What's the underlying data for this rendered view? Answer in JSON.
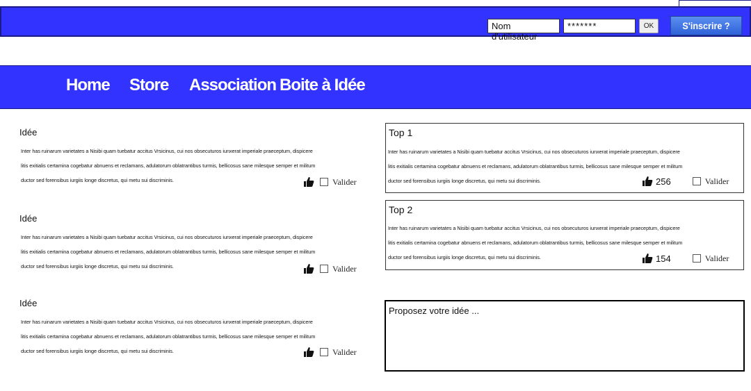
{
  "header": {
    "username_label": "Nom d'utilisateur",
    "password_mask": "*******",
    "ok_label": "OK",
    "signup_label": "S'inscrire ?"
  },
  "nav": {
    "items": [
      {
        "label": "Home"
      },
      {
        "label": "Store"
      },
      {
        "label": "Association"
      },
      {
        "label": "Boite à Idée"
      }
    ]
  },
  "lorem": {
    "line1": "Inter has ruinarum varietates a Nisibi quam tuebatur accitus Vrsicinus, cui nos obsecuturos iunxerat imperiale praeceptum, dispicere",
    "line2": "litis exitialis certamina cogebatur abnuens et reclamans, adulatorum oblatrantibus turmis, bellicosus sane milesque semper et militum",
    "line3": "ductor sed forensibus iurgiis longe discretus, qui metu sui discriminis."
  },
  "ideas": [
    {
      "title": "Idée",
      "validate_label": "Valider"
    },
    {
      "title": "Idée",
      "validate_label": "Valider"
    },
    {
      "title": "Idée",
      "validate_label": "Valider"
    }
  ],
  "top_ideas": [
    {
      "title": "Top 1",
      "votes": "256",
      "validate_label": "Valider"
    },
    {
      "title": "Top 2",
      "votes": "154",
      "validate_label": "Valider"
    }
  ],
  "propose": {
    "placeholder": "Proposez votre idée ..."
  },
  "colors": {
    "bar_blue": "#3333ff",
    "signup_blue": "#3f74e3"
  },
  "icons": {
    "vote": "thumbs-up-icon",
    "validate": "checkbox-icon"
  }
}
